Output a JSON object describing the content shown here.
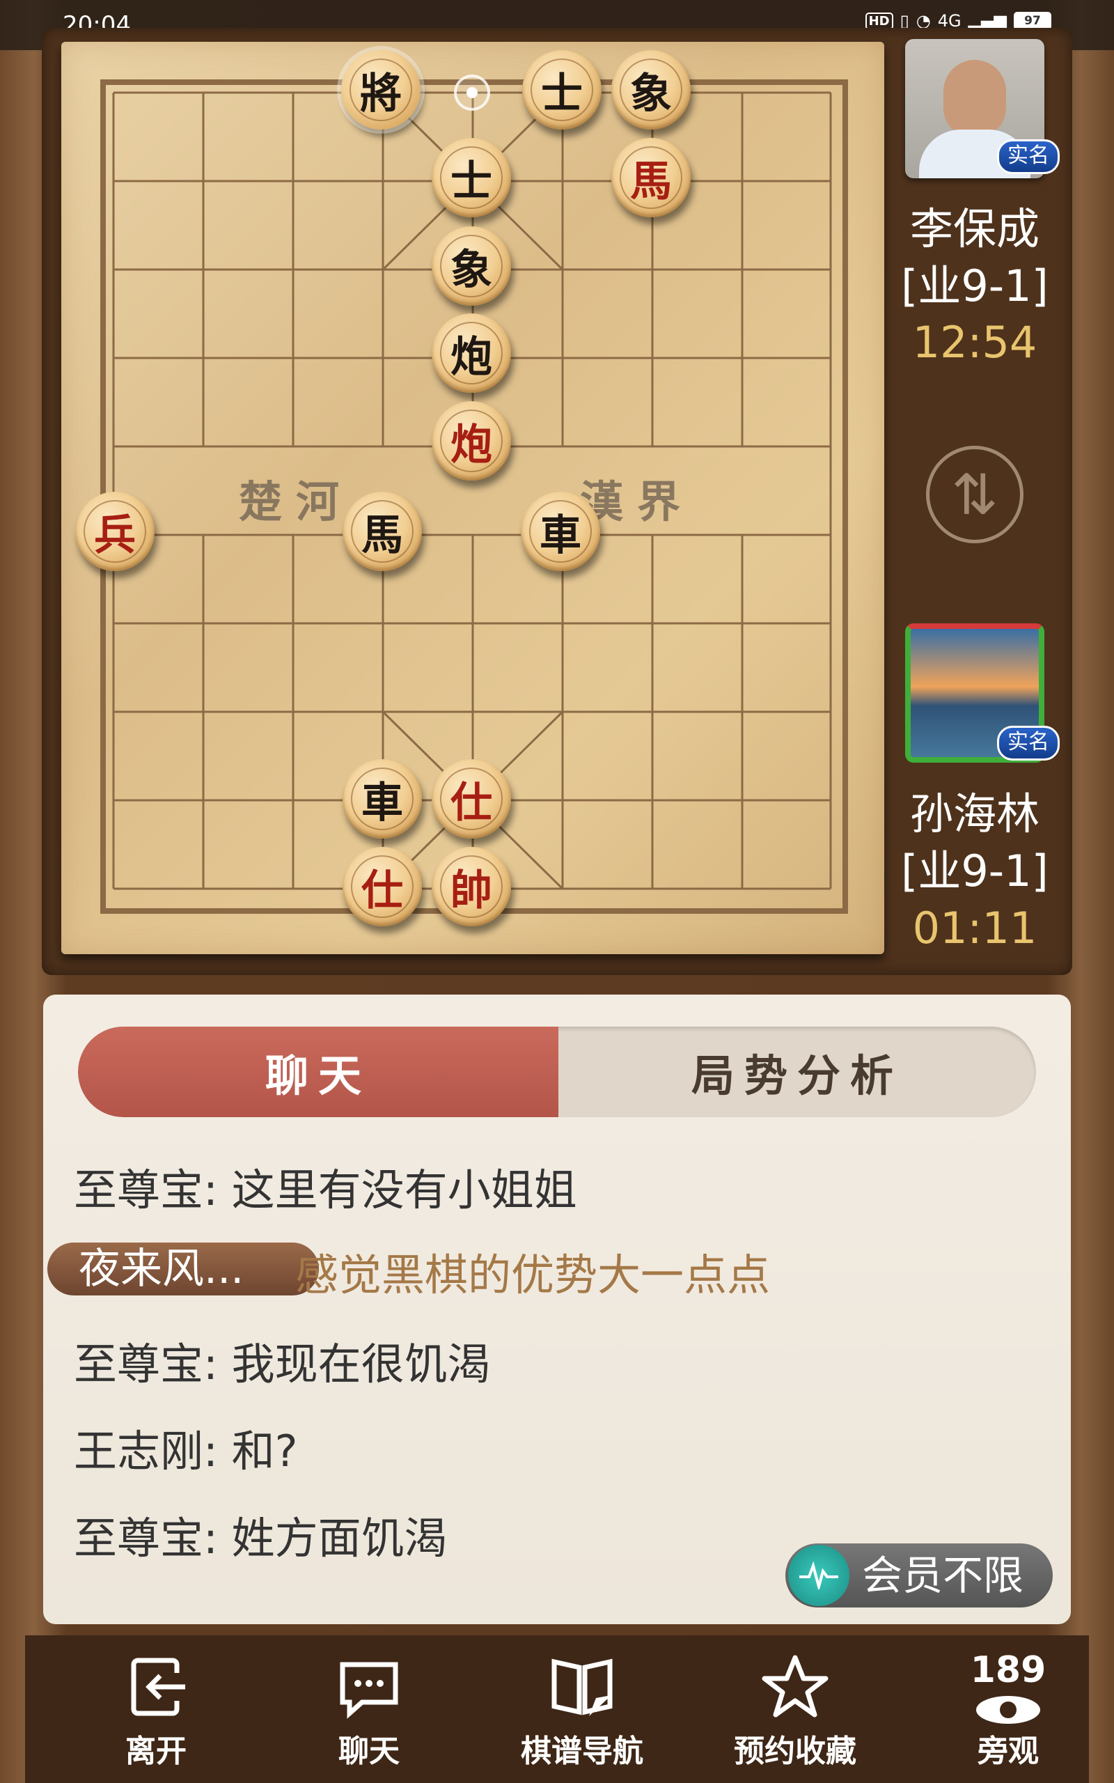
{
  "status_bar": {
    "time": "20:04",
    "network": "4G",
    "battery": "97"
  },
  "board": {
    "river_left": "楚河",
    "river_right": "漢界",
    "pieces": [
      {
        "label": "將",
        "side": "black",
        "name": "black-general-piece"
      },
      {
        "label": "士",
        "side": "black",
        "name": "black-advisor-piece-top"
      },
      {
        "label": "象",
        "side": "black",
        "name": "black-elephant-piece-top"
      },
      {
        "label": "士",
        "side": "black",
        "name": "black-advisor-piece"
      },
      {
        "label": "馬",
        "side": "red",
        "name": "red-horse-piece-top"
      },
      {
        "label": "象",
        "side": "black",
        "name": "black-elephant-piece"
      },
      {
        "label": "炮",
        "side": "black",
        "name": "black-cannon-piece"
      },
      {
        "label": "炮",
        "side": "red",
        "name": "red-cannon-piece"
      },
      {
        "label": "兵",
        "side": "red",
        "name": "red-soldier-piece"
      },
      {
        "label": "馬",
        "side": "black",
        "name": "black-horse-piece"
      },
      {
        "label": "車",
        "side": "black",
        "name": "black-chariot-piece"
      },
      {
        "label": "車",
        "side": "black",
        "name": "black-chariot-piece-bottom"
      },
      {
        "label": "仕",
        "side": "red",
        "name": "red-advisor-piece-right"
      },
      {
        "label": "仕",
        "side": "red",
        "name": "red-advisor-piece-left"
      },
      {
        "label": "帥",
        "side": "red",
        "name": "red-general-piece"
      }
    ]
  },
  "players": {
    "top": {
      "name": "李保成",
      "rank": "[业9-1]",
      "clock": "12:54",
      "badge": "实名"
    },
    "bottom": {
      "name": "孙海林",
      "rank": "[业9-1]",
      "clock": "01:11",
      "badge": "实名"
    }
  },
  "swap_icon": "swap-arrows-icon",
  "chat": {
    "tabs": {
      "chat": "聊天",
      "analysis": "局势分析"
    },
    "messages": [
      "至尊宝: 这里有没有小姐姐",
      "至尊宝: 我现在很饥渴",
      "王志刚: 和?",
      "至尊宝: 姓方面饥渴"
    ],
    "highlight": {
      "tag": "夜来风...",
      "text": "感觉黑棋的优势大一点点"
    },
    "vip": "会员不限"
  },
  "bottom_nav": {
    "leave": "离开",
    "chat": "聊天",
    "record_nav": "棋谱导航",
    "bookmark": "预约收藏",
    "spectate": "旁观",
    "spectator_count": "189"
  },
  "colors": {
    "accent_red": "#b4554a",
    "clock_gold": "#e9c46f",
    "board": "#e5c995"
  }
}
